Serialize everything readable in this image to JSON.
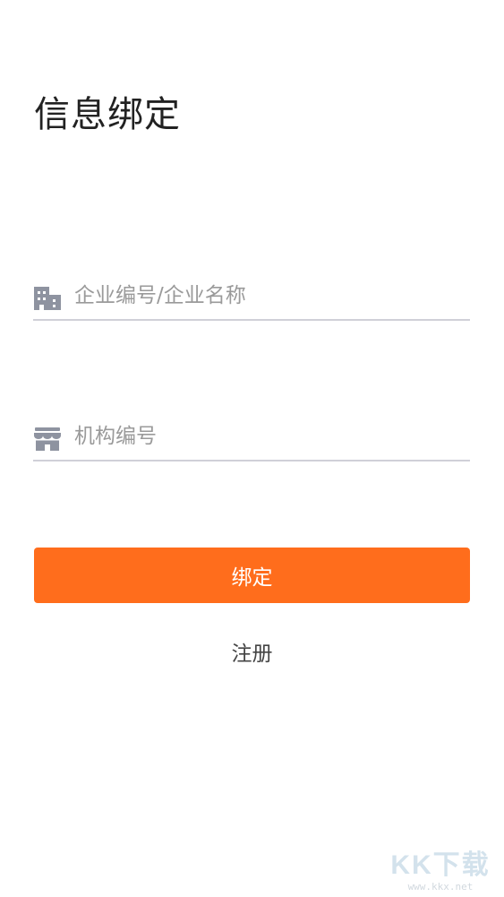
{
  "header": {
    "title": "信息绑定"
  },
  "form": {
    "company_field": {
      "placeholder": "企业编号/企业名称",
      "value": "",
      "icon": "building-icon"
    },
    "org_field": {
      "placeholder": "机构编号",
      "value": "",
      "icon": "store-icon"
    },
    "bind_label": "绑定",
    "register_label": "注册"
  },
  "watermark": {
    "brand": "KK下载",
    "url": "www.kkx.net"
  },
  "colors": {
    "accent": "#ff6d1c",
    "icon": "#8e93a0",
    "underline": "#d0d0d8"
  }
}
